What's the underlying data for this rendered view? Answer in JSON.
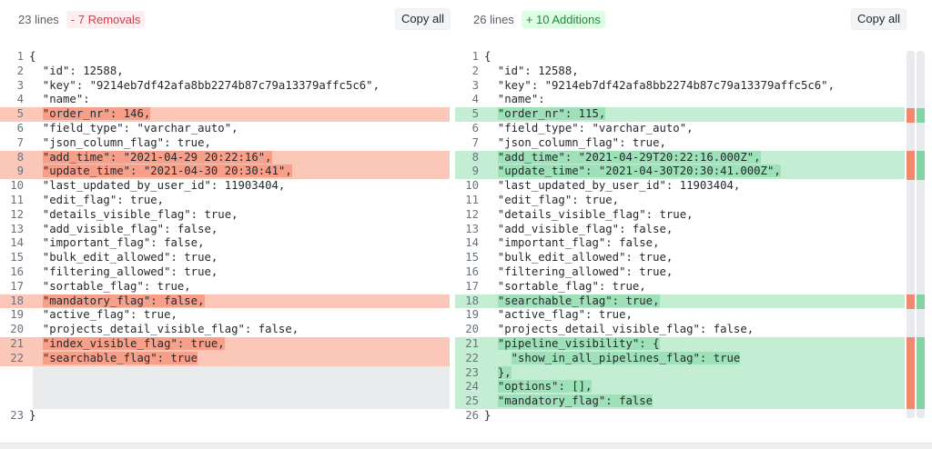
{
  "left": {
    "lines_label": "23 lines",
    "badge": "- 7 Removals",
    "copy_label": "Copy all",
    "rows": [
      {
        "n": "1",
        "t": "{",
        "k": "ctx"
      },
      {
        "n": "2",
        "t": "  \"id\": 12588,",
        "k": "ctx"
      },
      {
        "n": "3",
        "t": "  \"key\": \"9214eb7df42afa8bb2274b87c79a13379affc5c6\",",
        "k": "ctx"
      },
      {
        "n": "4",
        "t": "  \"name\":",
        "k": "ctx"
      },
      {
        "n": "5",
        "t": "  \"order_nr\": 146,",
        "k": "del"
      },
      {
        "n": "6",
        "t": "  \"field_type\": \"varchar_auto\",",
        "k": "ctx"
      },
      {
        "n": "7",
        "t": "  \"json_column_flag\": true,",
        "k": "ctx"
      },
      {
        "n": "8",
        "t": "  \"add_time\": \"2021-04-29 20:22:16\",",
        "k": "del"
      },
      {
        "n": "9",
        "t": "  \"update_time\": \"2021-04-30 20:30:41\",",
        "k": "del"
      },
      {
        "n": "10",
        "t": "  \"last_updated_by_user_id\": 11903404,",
        "k": "ctx"
      },
      {
        "n": "11",
        "t": "  \"edit_flag\": true,",
        "k": "ctx"
      },
      {
        "n": "12",
        "t": "  \"details_visible_flag\": true,",
        "k": "ctx"
      },
      {
        "n": "13",
        "t": "  \"add_visible_flag\": false,",
        "k": "ctx"
      },
      {
        "n": "14",
        "t": "  \"important_flag\": false,",
        "k": "ctx"
      },
      {
        "n": "15",
        "t": "  \"bulk_edit_allowed\": true,",
        "k": "ctx"
      },
      {
        "n": "16",
        "t": "  \"filtering_allowed\": true,",
        "k": "ctx"
      },
      {
        "n": "17",
        "t": "  \"sortable_flag\": true,",
        "k": "ctx"
      },
      {
        "n": "18",
        "t": "  \"mandatory_flag\": false,",
        "k": "del"
      },
      {
        "n": "19",
        "t": "  \"active_flag\": true,",
        "k": "ctx"
      },
      {
        "n": "20",
        "t": "  \"projects_detail_visible_flag\": false,",
        "k": "ctx"
      },
      {
        "n": "21",
        "t": "  \"index_visible_flag\": true,",
        "k": "del"
      },
      {
        "n": "22",
        "t": "  \"searchable_flag\": true",
        "k": "del"
      },
      {
        "n": "",
        "t": "",
        "k": "gap"
      },
      {
        "n": "23",
        "t": "}",
        "k": "ctx"
      }
    ]
  },
  "right": {
    "lines_label": "26 lines",
    "badge": "+ 10 Additions",
    "copy_label": "Copy all",
    "rows": [
      {
        "n": "1",
        "t": "{",
        "k": "ctx"
      },
      {
        "n": "2",
        "t": "  \"id\": 12588,",
        "k": "ctx"
      },
      {
        "n": "3",
        "t": "  \"key\": \"9214eb7df42afa8bb2274b87c79a13379affc5c6\",",
        "k": "ctx"
      },
      {
        "n": "4",
        "t": "  \"name\":",
        "k": "ctx"
      },
      {
        "n": "5",
        "t": "  \"order_nr\": 115,",
        "k": "add"
      },
      {
        "n": "6",
        "t": "  \"field_type\": \"varchar_auto\",",
        "k": "ctx"
      },
      {
        "n": "7",
        "t": "  \"json_column_flag\": true,",
        "k": "ctx"
      },
      {
        "n": "8",
        "t": "  \"add_time\": \"2021-04-29T20:22:16.000Z\",",
        "k": "add"
      },
      {
        "n": "9",
        "t": "  \"update_time\": \"2021-04-30T20:30:41.000Z\",",
        "k": "add"
      },
      {
        "n": "10",
        "t": "  \"last_updated_by_user_id\": 11903404,",
        "k": "ctx"
      },
      {
        "n": "11",
        "t": "  \"edit_flag\": true,",
        "k": "ctx"
      },
      {
        "n": "12",
        "t": "  \"details_visible_flag\": true,",
        "k": "ctx"
      },
      {
        "n": "13",
        "t": "  \"add_visible_flag\": false,",
        "k": "ctx"
      },
      {
        "n": "14",
        "t": "  \"important_flag\": false,",
        "k": "ctx"
      },
      {
        "n": "15",
        "t": "  \"bulk_edit_allowed\": true,",
        "k": "ctx"
      },
      {
        "n": "16",
        "t": "  \"filtering_allowed\": true,",
        "k": "ctx"
      },
      {
        "n": "17",
        "t": "  \"sortable_flag\": true,",
        "k": "ctx"
      },
      {
        "n": "18",
        "t": "  \"searchable_flag\": true,",
        "k": "add"
      },
      {
        "n": "19",
        "t": "  \"active_flag\": true,",
        "k": "ctx"
      },
      {
        "n": "20",
        "t": "  \"projects_detail_visible_flag\": false,",
        "k": "ctx"
      },
      {
        "n": "21",
        "t": "  \"pipeline_visibility\": {",
        "k": "add"
      },
      {
        "n": "22",
        "t": "    \"show_in_all_pipelines_flag\": true",
        "k": "add"
      },
      {
        "n": "23",
        "t": "  },",
        "k": "add"
      },
      {
        "n": "24",
        "t": "  \"options\": [],",
        "k": "add"
      },
      {
        "n": "25",
        "t": "  \"mandatory_flag\": false",
        "k": "add"
      },
      {
        "n": "26",
        "t": "}",
        "k": "ctx"
      }
    ]
  },
  "colors": {
    "removed_line": "#fbc7b9",
    "removed_highlight": "#f89f8a",
    "added_line": "#c4eed3",
    "added_highlight": "#9ee0b8",
    "removed_badge_text": "#d73a49",
    "added_badge_text": "#22863a"
  }
}
